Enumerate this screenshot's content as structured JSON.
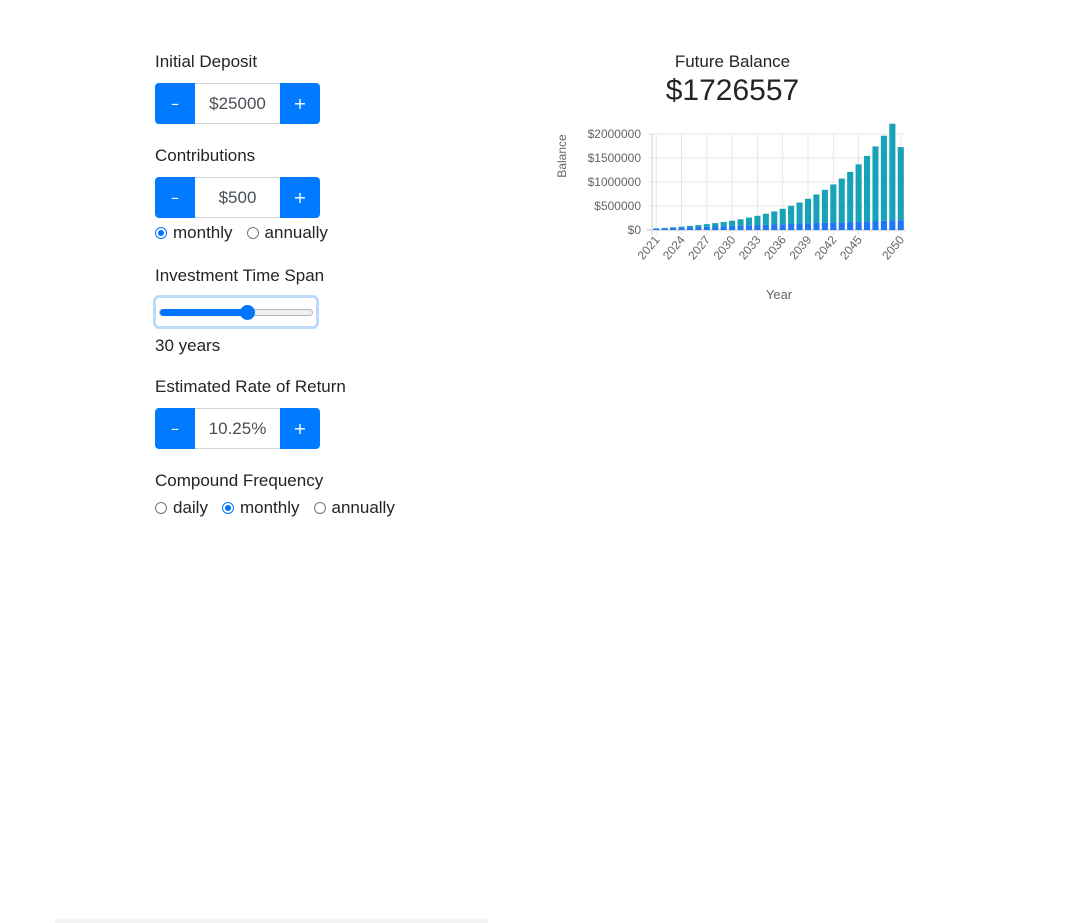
{
  "inputs": {
    "initial_deposit": {
      "label": "Initial Deposit",
      "value": "$25000",
      "minus_label": "–",
      "plus_label": "+"
    },
    "contributions": {
      "label": "Contributions",
      "value": "$500",
      "minus_label": "–",
      "plus_label": "+",
      "frequency_options": [
        "monthly",
        "annually"
      ],
      "frequency_selected": "monthly"
    },
    "time_span": {
      "label": "Investment Time Span",
      "value_text": "30 years",
      "slider_fraction": 0.57
    },
    "rate_of_return": {
      "label": "Estimated Rate of Return",
      "value": "10.25%",
      "minus_label": "–",
      "plus_label": "+"
    },
    "compound_frequency": {
      "label": "Compound Frequency",
      "options": [
        "daily",
        "monthly",
        "annually"
      ],
      "selected": "monthly"
    }
  },
  "summary": {
    "title": "Future Balance",
    "amount": "$1726557"
  },
  "colors": {
    "primary": "#007bff",
    "principal_bar": "#1f77f4",
    "interest_bar": "#17a2b8"
  },
  "chart_data": {
    "type": "bar",
    "stacked": true,
    "xlabel": "Year",
    "ylabel": "Balance",
    "ylim": [
      0,
      2000000
    ],
    "y_ticks": [
      "$0",
      "$500000",
      "$1000000",
      "$1500000",
      "$2000000"
    ],
    "y_tick_values": [
      0,
      500000,
      1000000,
      1500000,
      2000000
    ],
    "x_tick_labels": [
      "2021",
      "2024",
      "2027",
      "2030",
      "2033",
      "2036",
      "2039",
      "2042",
      "2045",
      "2050"
    ],
    "x_tick_years": [
      2021,
      2024,
      2027,
      2030,
      2033,
      2036,
      2039,
      2042,
      2045,
      2050
    ],
    "categories": [
      "2021",
      "2022",
      "2023",
      "2024",
      "2025",
      "2026",
      "2027",
      "2028",
      "2029",
      "2030",
      "2031",
      "2032",
      "2033",
      "2034",
      "2035",
      "2036",
      "2037",
      "2038",
      "2039",
      "2040",
      "2041",
      "2042",
      "2043",
      "2044",
      "2045",
      "2046",
      "2047",
      "2048",
      "2049",
      "2050"
    ],
    "series": [
      {
        "values": [
          31000,
          37000,
          43000,
          49000,
          55000,
          61000,
          67000,
          73000,
          79000,
          85000,
          91000,
          97000,
          103000,
          109000,
          115000,
          121000,
          127000,
          133000,
          139000,
          145000,
          151000,
          157000,
          163000,
          169000,
          175000,
          181000,
          187000,
          193000,
          199000,
          205000
        ]
      },
      {
        "values": [
          3000,
          8000,
          14000,
          22000,
          31000,
          42000,
          55000,
          70000,
          88000,
          109000,
          133000,
          161000,
          193000,
          230000,
          272000,
          321000,
          377000,
          440000,
          512000,
          594000,
          686000,
          791000,
          909000,
          1042000,
          1193000,
          1363000,
          1555000,
          1771000,
          2015000,
          1521557
        ]
      }
    ]
  }
}
